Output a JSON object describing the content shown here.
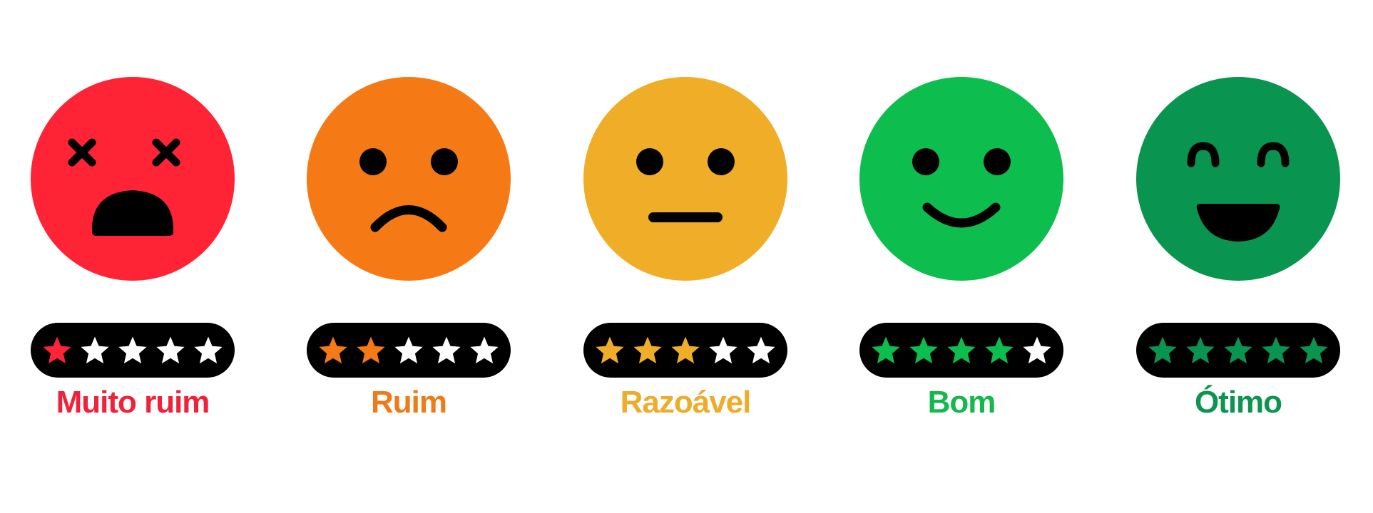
{
  "ratings": [
    {
      "id": "muito-ruim",
      "label": "Muito ruim",
      "color": "#fe2436",
      "label_color": "#f2213a",
      "expression": "dizzy-shocked",
      "stars_filled": 1,
      "stars_total": 5
    },
    {
      "id": "ruim",
      "label": "Ruim",
      "color": "#f57a16",
      "label_color": "#f07a18",
      "expression": "sad",
      "stars_filled": 2,
      "stars_total": 5
    },
    {
      "id": "razoavel",
      "label": "Razoável",
      "color": "#f0ae28",
      "label_color": "#eeac2b",
      "expression": "neutral",
      "stars_filled": 3,
      "stars_total": 5
    },
    {
      "id": "bom",
      "label": "Bom",
      "color": "#0dbd4d",
      "label_color": "#14b84c",
      "expression": "smile",
      "stars_filled": 4,
      "stars_total": 5
    },
    {
      "id": "otimo",
      "label": "Ótimo",
      "color": "#09954f",
      "label_color": "#0c9450",
      "expression": "laughing",
      "stars_filled": 5,
      "stars_total": 5
    }
  ],
  "colors": {
    "pill_background": "#000000",
    "empty_star": "#ffffff",
    "feature": "#000000"
  }
}
